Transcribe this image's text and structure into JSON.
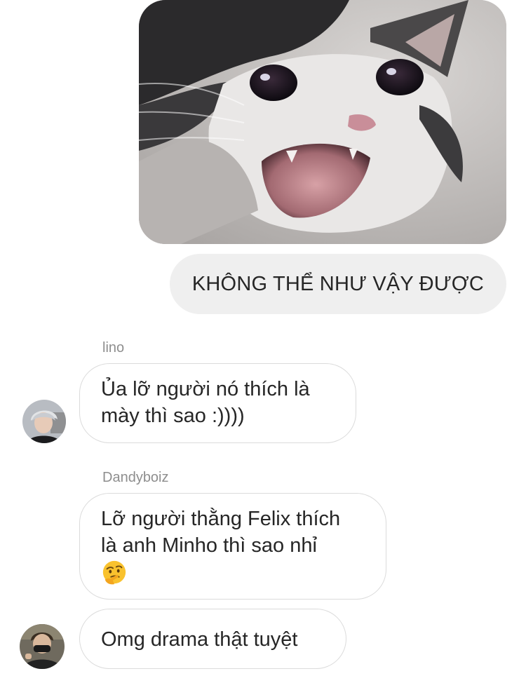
{
  "conversation": {
    "sent_image": {
      "icon": "crying-cat-photo"
    },
    "sent_message": {
      "text": "KHÔNG THỂ NHƯ VẬY ĐƯỢC"
    },
    "messages": [
      {
        "sender": "lino",
        "lines": [
          "Ủa lỡ người nó thích là",
          "mày thì sao :))))"
        ]
      },
      {
        "sender": "Dandyboiz",
        "lines": [
          "Lỡ người thằng Felix thích",
          "là anh Minho thì sao nhỉ"
        ],
        "emoji": "thinking-face-icon"
      },
      {
        "lines": [
          "Omg drama thật tuyệt"
        ]
      }
    ]
  },
  "colors": {
    "sent_bubble": "#efefef",
    "recv_border": "#dbdbdb",
    "sender_name": "#8e8e8e",
    "text": "#262626"
  }
}
